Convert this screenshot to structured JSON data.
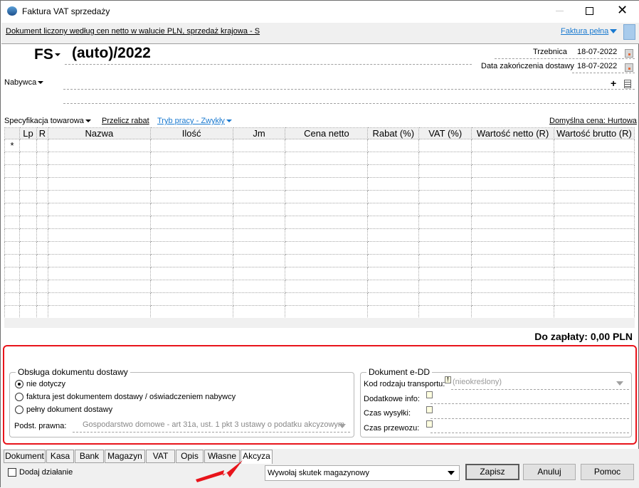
{
  "window": {
    "title": "Faktura VAT sprzedaży"
  },
  "infobar": {
    "description": "Dokument liczony według cen netto w walucie PLN, sprzedaż krajowa - S",
    "invoice_type": "Faktura pełna"
  },
  "header": {
    "doc_type": "FS",
    "number": "(auto)/2022",
    "place_label": "Trzebnica",
    "place_date": "18-07-2022",
    "delivery_label": "Data zakończenia dostawy",
    "delivery_date": "18-07-2022",
    "buyer_label": "Nabywca"
  },
  "toolbar": {
    "spec": "Specyfikacja towarowa",
    "recalc": "Przelicz rabat",
    "mode": "Tryb pracy - Zwykły",
    "default_price": "Domyślna cena: Hurtowa"
  },
  "grid": {
    "columns": [
      "",
      "Lp",
      "R",
      "Nazwa",
      "Ilość",
      "Jm",
      "Cena netto",
      "Rabat (%)",
      "VAT (%)",
      "Wartość netto (R)",
      "Wartość brutto (R)"
    ],
    "new_row_marker": "*"
  },
  "total": "Do zapłaty: 0,00 PLN",
  "delivery_group": {
    "title": "Obsługa dokumentu dostawy",
    "options": [
      "nie dotyczy",
      "faktura jest dokumentem dostawy / oświadczeniem nabywcy",
      "pełny dokument dostawy"
    ],
    "selected": 0,
    "legal_label": "Podst. prawna:",
    "legal_value": "Gospodarstwo domowe - art 31a, ust. 1 pkt 3 ustawy o podatku akcyzowym"
  },
  "edd_group": {
    "title": "Dokument e-DD",
    "transport_label": "Kod rodzaju transportu:",
    "transport_value": "(nieokreślony)",
    "info_label": "Dodatkowe info:",
    "ship_label": "Czas wysyłki:",
    "transit_label": "Czas przewozu:"
  },
  "tabs": [
    "Dokument",
    "Kasa",
    "Bank",
    "Magazyn",
    "VAT",
    "Opis",
    "Własne",
    "Akcyza"
  ],
  "active_tab": "Akcyza",
  "footer": {
    "add_action": "Dodaj działanie",
    "warehouse_action": "Wywołaj skutek magazynowy",
    "save": "Zapisz",
    "cancel": "Anuluj",
    "help": "Pomoc"
  },
  "colors": {
    "accent": "#1a7ad0",
    "highlight": "#e8141b"
  }
}
